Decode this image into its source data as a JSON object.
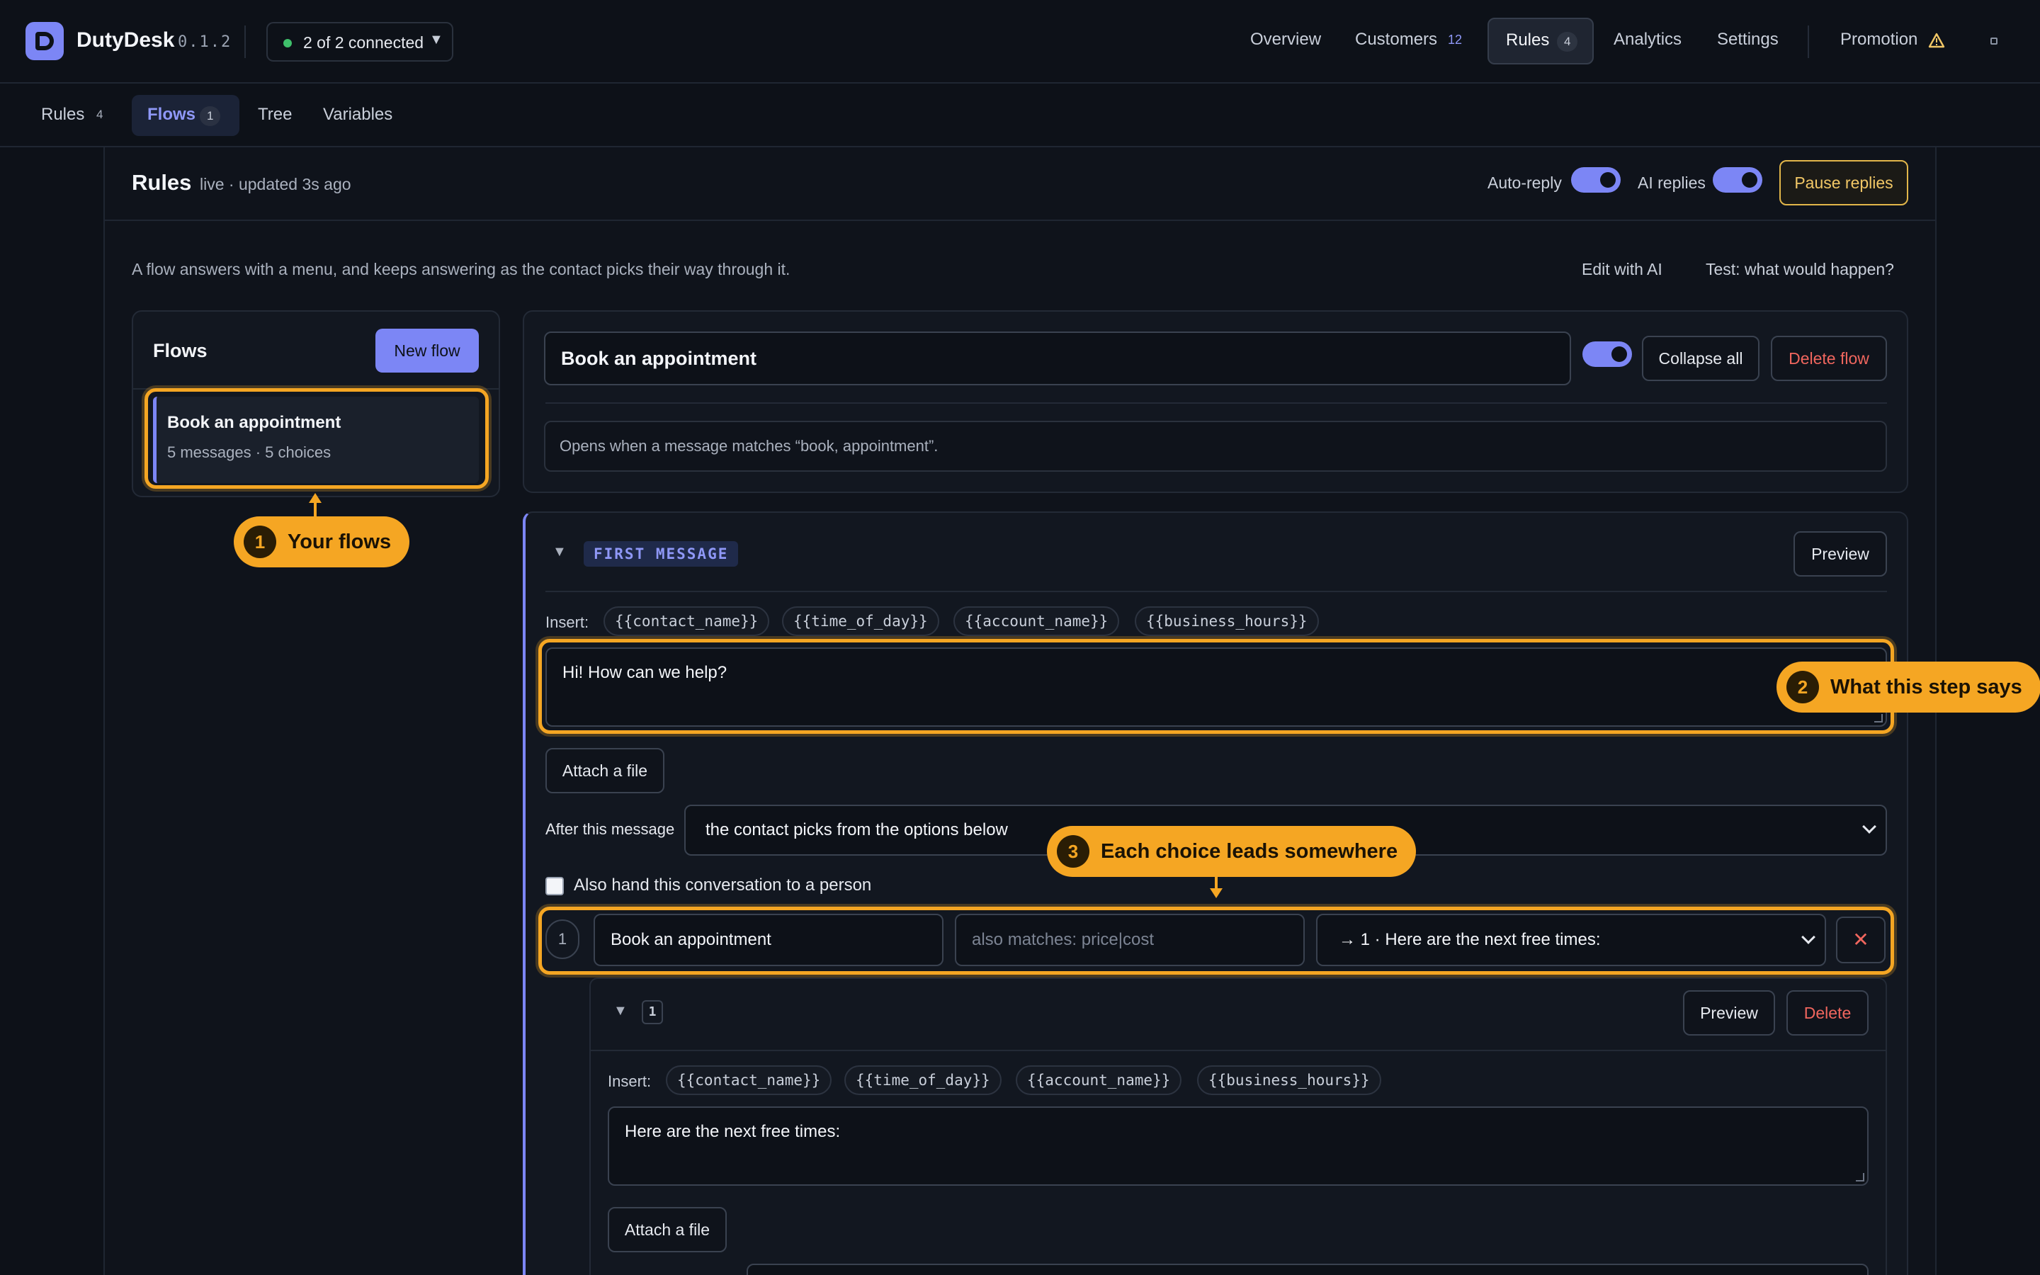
{
  "app": {
    "name": "DutyDesk",
    "version": "0.1.2",
    "connection": "2 of 2 connected"
  },
  "nav": {
    "overview": "Overview",
    "customers": "Customers",
    "customers_count": "12",
    "rules": "Rules",
    "rules_count": "4",
    "analytics": "Analytics",
    "settings": "Settings",
    "promotion": "Promotion"
  },
  "subtabs": {
    "rules": "Rules",
    "rules_count": "4",
    "flows": "Flows",
    "flows_count": "1",
    "tree": "Tree",
    "variables": "Variables"
  },
  "header": {
    "title": "Rules",
    "status": "live · updated 3s ago",
    "auto_reply": "Auto-reply",
    "ai_replies": "AI replies",
    "pause": "Pause replies"
  },
  "description": "A flow answers with a menu, and keeps answering as the contact picks their way through it.",
  "actions": {
    "edit_ai": "Edit with AI",
    "test": "Test: what would happen?"
  },
  "flows_panel": {
    "title": "Flows",
    "new_flow": "New flow",
    "items": [
      {
        "name": "Book an appointment",
        "meta": "5 messages · 5 choices"
      }
    ]
  },
  "flow": {
    "name": "Book an appointment",
    "collapse_all": "Collapse all",
    "delete_flow": "Delete flow",
    "opens": "Opens when a message matches “book, appointment”."
  },
  "step": {
    "label": "FIRST MESSAGE",
    "preview": "Preview",
    "insert_label": "Insert:",
    "chips": [
      "{{contact_name}}",
      "{{time_of_day}}",
      "{{account_name}}",
      "{{business_hours}}"
    ],
    "message": "Hi! How can we help?",
    "attach": "Attach a file",
    "after_label": "After this message",
    "after_value": "the contact picks from the options below",
    "handoff": "Also hand this conversation to a person",
    "choice": {
      "number": "1",
      "label": "Book an appointment",
      "matches_placeholder": "also matches: price|cost",
      "target": "→ 1 · Here are the next free times:",
      "remove": "✕"
    }
  },
  "nested": {
    "number": "1",
    "preview": "Preview",
    "delete": "Delete",
    "insert_label": "Insert:",
    "chips": [
      "{{contact_name}}",
      "{{time_of_day}}",
      "{{account_name}}",
      "{{business_hours}}"
    ],
    "message": "Here are the next free times:",
    "attach": "Attach a file"
  },
  "callouts": {
    "c1": {
      "num": "1",
      "text": "Your flows"
    },
    "c2": {
      "num": "2",
      "text": "What this step says"
    },
    "c3": {
      "num": "3",
      "text": "Each choice leads somewhere"
    }
  },
  "colors": {
    "accent": "#7c86f5",
    "highlight": "#f5a623",
    "danger": "#f0665e",
    "warning": "#e2b64a",
    "online": "#3fc06b"
  }
}
